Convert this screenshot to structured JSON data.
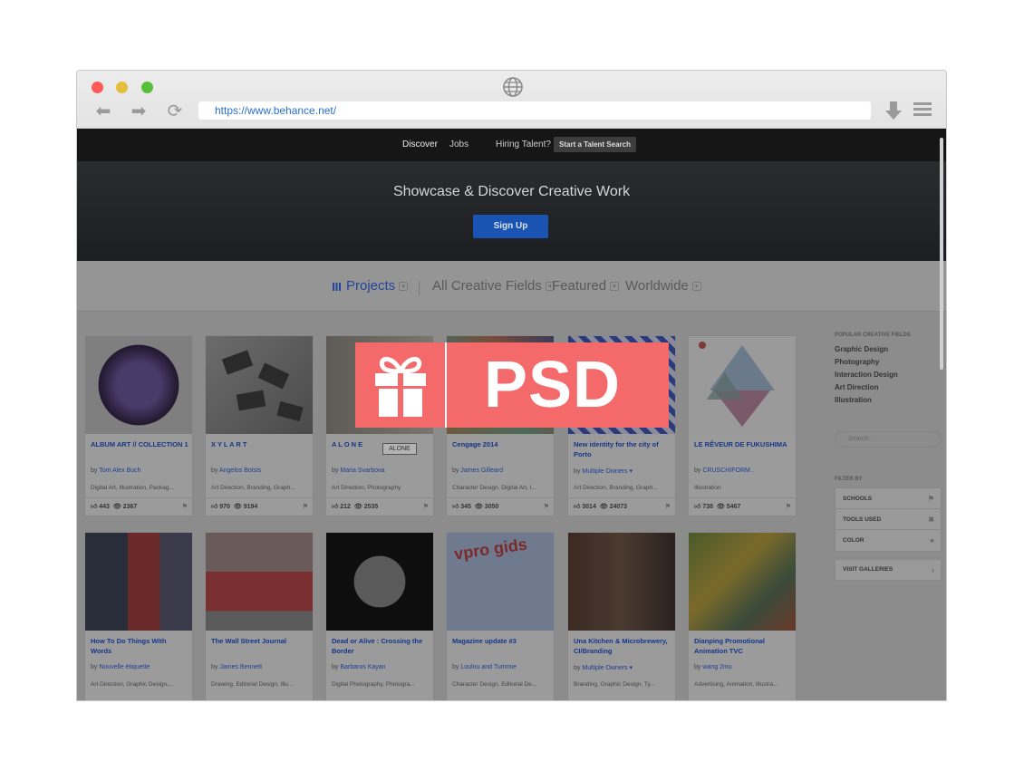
{
  "browser": {
    "url": "https://www.behance.net/"
  },
  "topnav": {
    "discover": "Discover",
    "jobs": "Jobs",
    "hiring": "Hiring Talent?",
    "talent_search": "Start a Talent Search"
  },
  "hero": {
    "title": "Showcase & Discover Creative Work",
    "signup": "Sign Up"
  },
  "filters": {
    "projects": "Projects",
    "fields": "All Creative Fields",
    "featured": "Featured",
    "worldwide": "Worldwide"
  },
  "cards": [
    {
      "title": "ALBUM ART // COLLECTION 1",
      "by": "by",
      "owner": "Tom Alex Buch",
      "fields": "Digital Art, Illustration, Packag...",
      "likes": "443",
      "views": "2367"
    },
    {
      "title": "X Y L A R T",
      "by": "by",
      "owner": "Angelos Botsis",
      "fields": "Art Direction, Branding, Graph...",
      "likes": "970",
      "views": "9194"
    },
    {
      "title": "A L O N E",
      "by": "by",
      "owner": "Maria Svarbova",
      "fields": "Art Direction, Photography",
      "likes": "212",
      "views": "2535"
    },
    {
      "title": "Cengage 2014",
      "by": "by",
      "owner": "James Gilleard",
      "fields": "Character Design, Digital Art, I...",
      "likes": "345",
      "views": "3050"
    },
    {
      "title": "New identity for the city of Porto",
      "by": "by",
      "owner": "Multiple Owners",
      "fields": "Art Direction, Branding, Graph...",
      "likes": "3014",
      "views": "24073"
    },
    {
      "title": "LE RÊVEUR DE FUKUSHIMA",
      "by": "by",
      "owner": "CRUSCHIFORM .",
      "fields": "Illustration",
      "likes": "738",
      "views": "5467"
    },
    {
      "title": "How To Do Things With Words",
      "by": "by",
      "owner": "Nouvelle étiquette",
      "fields": "Art Direction, Graphic Design,..."
    },
    {
      "title": "The Wall Street Journal",
      "by": "by",
      "owner": "James Bennett",
      "fields": "Drawing, Editorial Design, Illu..."
    },
    {
      "title": "Dead or Alive : Crossing the Border",
      "by": "by",
      "owner": "Barbaros Kayan",
      "fields": "Digital Photography, Photogra..."
    },
    {
      "title": "Magazine update #3",
      "by": "by",
      "owner": "Loulou and Tummie",
      "fields": "Character Design, Editorial De..."
    },
    {
      "title": "Una Kitchen & Microbrewery, CI/Branding",
      "by": "by",
      "owner": "Multiple Owners",
      "fields": "Branding, Graphic Design, Ty..."
    },
    {
      "title": "Dianping Promotional Animation TVC",
      "by": "by",
      "owner": "wang 2mu",
      "fields": "Advertising, Animation, Illustra..."
    }
  ],
  "alone_tag": "ALONE",
  "sidebar": {
    "popular_head": "POPULAR CREATIVE FIELDS",
    "popular": [
      "Graphic Design",
      "Photography",
      "Interaction Design",
      "Art Direction",
      "Illustration"
    ],
    "search_placeholder": "Search...",
    "filter_by": "FILTER BY",
    "filters": [
      "SCHOOLS",
      "TOOLS USED",
      "COLOR"
    ],
    "visit": "VISIT GALLERIES"
  },
  "badge": {
    "text": "PSD",
    "color": "#f4696a"
  },
  "icons": [
    "globe-icon",
    "back-arrow-icon",
    "forward-arrow-icon",
    "reload-icon",
    "download-icon",
    "menu-icon",
    "gift-icon",
    "grid-icon",
    "thumbs-up-icon",
    "eye-icon"
  ]
}
